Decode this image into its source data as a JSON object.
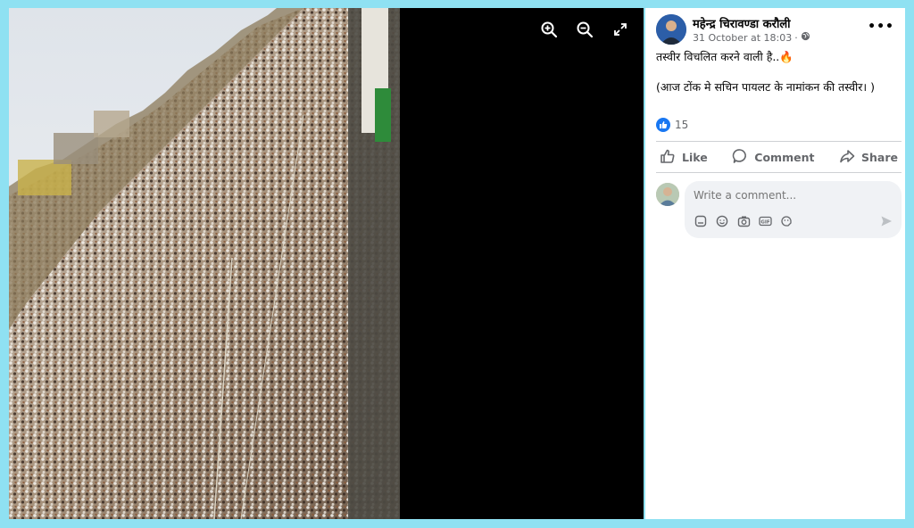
{
  "post": {
    "author": "महेन्द्र चिरावण्डा करौली",
    "timestamp": "31 October at 18:03",
    "separator": "·",
    "audience_icon": "globe-icon",
    "more_label": "•••",
    "text_line1": "तस्वीर विचलित करने वाली है..🔥",
    "text_line2": "(आज टोंक मे सचिन पायलट के नामांकन की तस्वीर। )",
    "reaction_count": "15"
  },
  "actions": {
    "like": "Like",
    "comment": "Comment",
    "share": "Share"
  },
  "comment_box": {
    "placeholder": "Write a comment...",
    "icons": [
      "sticker-icon",
      "emoji-icon",
      "camera-icon",
      "gif-icon",
      "avatar-sticker-icon"
    ]
  },
  "viewer": {
    "controls": [
      "zoom-in-icon",
      "zoom-out-icon",
      "fullscreen-icon"
    ]
  },
  "colors": {
    "accent": "#1877f2",
    "frame": "#8fe1f2",
    "text_secondary": "#65676b"
  }
}
